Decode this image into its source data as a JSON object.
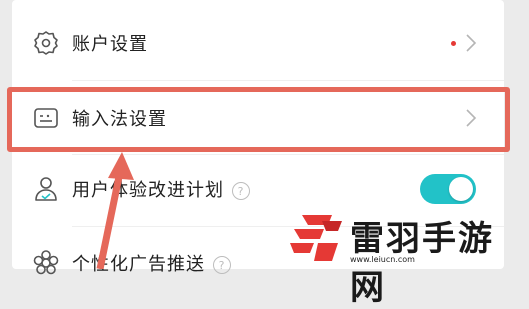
{
  "settings": {
    "items": [
      {
        "label": "账户设置",
        "icon": "gear-icon",
        "has_dot": true
      },
      {
        "label": "输入法设置",
        "icon": "keyboard-settings-icon",
        "highlighted": true
      },
      {
        "label": "用户体验改进计划",
        "icon": "user-shield-icon",
        "help": "?",
        "toggle": "on"
      },
      {
        "label": "个性化广告推送",
        "icon": "flower-icon",
        "help": "?"
      }
    ]
  },
  "colors": {
    "highlight": "#e5685a",
    "toggle_on": "#22c2c8",
    "dot": "#e53935",
    "watermark_red": "#e53935"
  },
  "watermark": {
    "title": "雷羽手游网",
    "url": "www.leiucn.com"
  }
}
